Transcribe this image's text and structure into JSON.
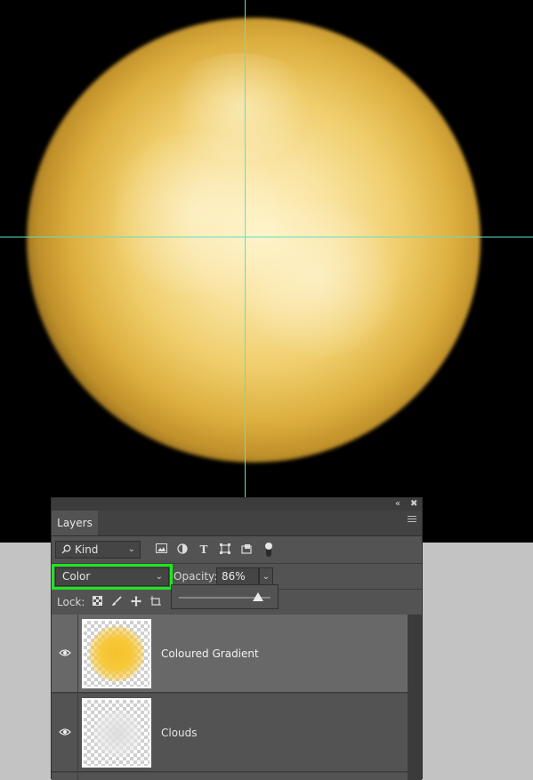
{
  "panel": {
    "tab_label": "Layers",
    "collapse_icon": "«",
    "close_icon": "✖"
  },
  "filter": {
    "kind_label": "Kind",
    "icons": [
      "image-filter-icon",
      "adjustment-filter-icon",
      "type-filter-icon",
      "shape-filter-icon",
      "smart-object-filter-icon",
      "filter-toggle"
    ]
  },
  "blend": {
    "mode": "Color",
    "opacity_label": "Opacity:",
    "opacity_value": "86%",
    "opacity_fraction": 0.86,
    "highlight_color": "#1ee61e"
  },
  "lock": {
    "label": "Lock:",
    "icons": [
      "lock-transparency-icon",
      "lock-paint-icon",
      "lock-position-icon",
      "lock-artboard-icon"
    ]
  },
  "layers": [
    {
      "name": "Coloured Gradient",
      "visible": true,
      "selected": true,
      "thumb_color": "#f5c22e"
    },
    {
      "name": "Clouds",
      "visible": true,
      "selected": false,
      "thumb_color": "#e5e5e5"
    }
  ],
  "guides_color": "#5fe0c9"
}
